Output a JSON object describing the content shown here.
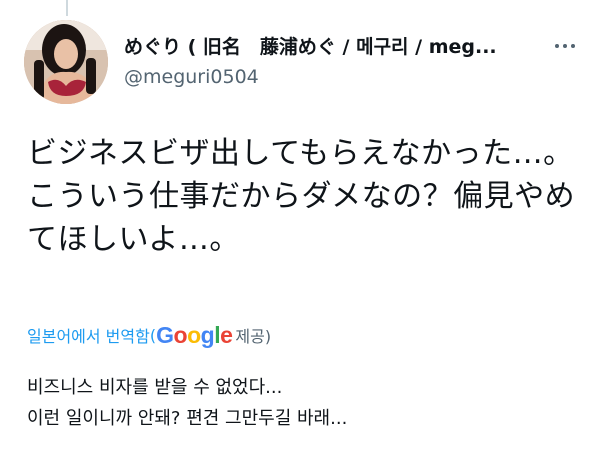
{
  "author": {
    "display_name": "めぐり ( 旧名　藤浦めぐ / 메구리 / meg...",
    "handle": "@meguri0504",
    "avatar_icon": "profile-photo"
  },
  "more_icon": "more-horizontal-icon",
  "tweet": {
    "lines": [
      "ビジネスビザ出してもらえなかった…。",
      "こういう仕事だからダメなの？偏見やめ",
      "てほしいよ…。"
    ]
  },
  "translation": {
    "label": "일본어에서 번역함",
    "open_paren": "(",
    "google_letters": [
      "G",
      "o",
      "o",
      "g",
      "l",
      "e"
    ],
    "provided": " 제공)",
    "lines": [
      "비즈니스 비자를 받을 수 없었다...",
      "이런 일이니까 안돼? 편견 그만두길 바래..."
    ]
  },
  "colors": {
    "link": "#1d9bf0",
    "muted": "#536471",
    "google": [
      "#4285F4",
      "#EA4335",
      "#FBBC05",
      "#4285F4",
      "#34A853",
      "#EA4335"
    ]
  }
}
